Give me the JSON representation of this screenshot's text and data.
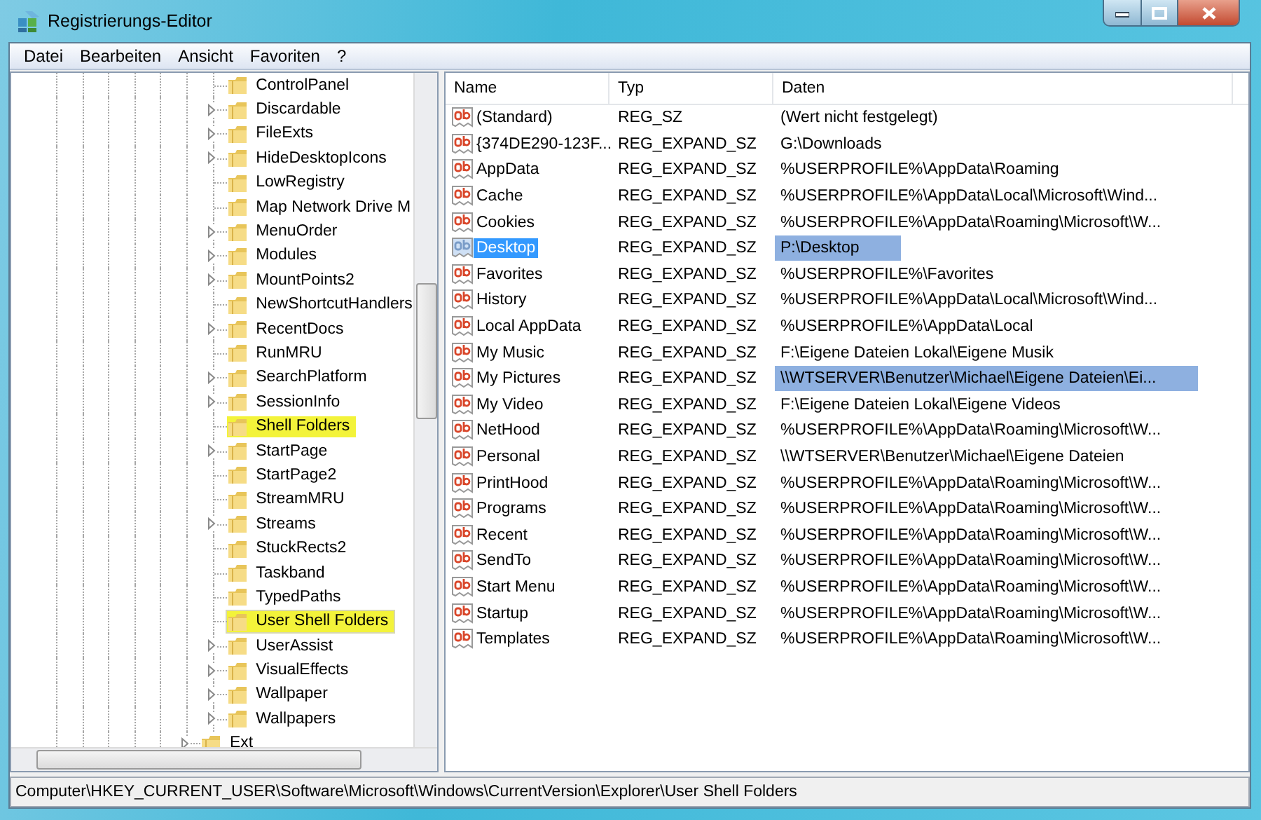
{
  "window": {
    "title": "Registrierungs-Editor"
  },
  "menu": [
    "Datei",
    "Bearbeiten",
    "Ansicht",
    "Favoriten",
    "?"
  ],
  "tree": [
    {
      "children": [
        {
          "label": "ControlPanel",
          "expandable": false,
          "highlighted": false,
          "selected": false
        },
        {
          "label": "Discardable",
          "expandable": true,
          "highlighted": false,
          "selected": false
        },
        {
          "label": "FileExts",
          "expandable": true,
          "highlighted": false,
          "selected": false
        },
        {
          "label": "HideDesktopIcons",
          "expandable": true,
          "highlighted": false,
          "selected": false
        },
        {
          "label": "LowRegistry",
          "expandable": false,
          "highlighted": false,
          "selected": false
        },
        {
          "label": "Map Network Drive M",
          "expandable": false,
          "highlighted": false,
          "selected": false
        },
        {
          "label": "MenuOrder",
          "expandable": true,
          "highlighted": false,
          "selected": false
        },
        {
          "label": "Modules",
          "expandable": true,
          "highlighted": false,
          "selected": false
        },
        {
          "label": "MountPoints2",
          "expandable": true,
          "highlighted": false,
          "selected": false
        },
        {
          "label": "NewShortcutHandlers",
          "expandable": false,
          "highlighted": false,
          "selected": false
        },
        {
          "label": "RecentDocs",
          "expandable": true,
          "highlighted": false,
          "selected": false
        },
        {
          "label": "RunMRU",
          "expandable": false,
          "highlighted": false,
          "selected": false
        },
        {
          "label": "SearchPlatform",
          "expandable": true,
          "highlighted": false,
          "selected": false
        },
        {
          "label": "SessionInfo",
          "expandable": true,
          "highlighted": false,
          "selected": false
        },
        {
          "label": "Shell Folders",
          "expandable": false,
          "highlighted": true,
          "selected": false
        },
        {
          "label": "StartPage",
          "expandable": true,
          "highlighted": false,
          "selected": false
        },
        {
          "label": "StartPage2",
          "expandable": false,
          "highlighted": false,
          "selected": false
        },
        {
          "label": "StreamMRU",
          "expandable": false,
          "highlighted": false,
          "selected": false
        },
        {
          "label": "Streams",
          "expandable": true,
          "highlighted": false,
          "selected": false
        },
        {
          "label": "StuckRects2",
          "expandable": false,
          "highlighted": false,
          "selected": false
        },
        {
          "label": "Taskband",
          "expandable": false,
          "highlighted": false,
          "selected": false
        },
        {
          "label": "TypedPaths",
          "expandable": false,
          "highlighted": false,
          "selected": false
        },
        {
          "label": "User Shell Folders",
          "expandable": false,
          "highlighted": true,
          "selected": true
        },
        {
          "label": "UserAssist",
          "expandable": true,
          "highlighted": false,
          "selected": false
        },
        {
          "label": "VisualEffects",
          "expandable": true,
          "highlighted": false,
          "selected": false
        },
        {
          "label": "Wallpaper",
          "expandable": true,
          "highlighted": false,
          "selected": false
        },
        {
          "label": "Wallpapers",
          "expandable": true,
          "highlighted": false,
          "selected": false
        }
      ]
    },
    {
      "label": "Ext",
      "expandable": true,
      "highlighted": false,
      "selected": false
    }
  ],
  "table": {
    "columns": [
      "Name",
      "Typ",
      "Daten"
    ],
    "rows": [
      {
        "name": "(Standard)",
        "type": "REG_SZ",
        "data": "(Wert nicht festgelegt)",
        "selected": false,
        "data_highlighted": false
      },
      {
        "name": "{374DE290-123F...",
        "type": "REG_EXPAND_SZ",
        "data": "G:\\Downloads",
        "selected": false,
        "data_highlighted": false
      },
      {
        "name": "AppData",
        "type": "REG_EXPAND_SZ",
        "data": "%USERPROFILE%\\AppData\\Roaming",
        "selected": false,
        "data_highlighted": false
      },
      {
        "name": "Cache",
        "type": "REG_EXPAND_SZ",
        "data": "%USERPROFILE%\\AppData\\Local\\Microsoft\\Wind...",
        "selected": false,
        "data_highlighted": false
      },
      {
        "name": "Cookies",
        "type": "REG_EXPAND_SZ",
        "data": "%USERPROFILE%\\AppData\\Roaming\\Microsoft\\W...",
        "selected": false,
        "data_highlighted": false
      },
      {
        "name": "Desktop",
        "type": "REG_EXPAND_SZ",
        "data": "P:\\Desktop",
        "selected": true,
        "data_highlighted": true
      },
      {
        "name": "Favorites",
        "type": "REG_EXPAND_SZ",
        "data": "%USERPROFILE%\\Favorites",
        "selected": false,
        "data_highlighted": false
      },
      {
        "name": "History",
        "type": "REG_EXPAND_SZ",
        "data": "%USERPROFILE%\\AppData\\Local\\Microsoft\\Wind...",
        "selected": false,
        "data_highlighted": false
      },
      {
        "name": "Local AppData",
        "type": "REG_EXPAND_SZ",
        "data": "%USERPROFILE%\\AppData\\Local",
        "selected": false,
        "data_highlighted": false
      },
      {
        "name": "My Music",
        "type": "REG_EXPAND_SZ",
        "data": "F:\\Eigene Dateien Lokal\\Eigene Musik",
        "selected": false,
        "data_highlighted": false
      },
      {
        "name": "My Pictures",
        "type": "REG_EXPAND_SZ",
        "data": "\\\\WTSERVER\\Benutzer\\Michael\\Eigene Dateien\\Ei...",
        "selected": false,
        "data_highlighted": true
      },
      {
        "name": "My Video",
        "type": "REG_EXPAND_SZ",
        "data": "F:\\Eigene Dateien Lokal\\Eigene Videos",
        "selected": false,
        "data_highlighted": false
      },
      {
        "name": "NetHood",
        "type": "REG_EXPAND_SZ",
        "data": "%USERPROFILE%\\AppData\\Roaming\\Microsoft\\W...",
        "selected": false,
        "data_highlighted": false
      },
      {
        "name": "Personal",
        "type": "REG_EXPAND_SZ",
        "data": "\\\\WTSERVER\\Benutzer\\Michael\\Eigene Dateien",
        "selected": false,
        "data_highlighted": false
      },
      {
        "name": "PrintHood",
        "type": "REG_EXPAND_SZ",
        "data": "%USERPROFILE%\\AppData\\Roaming\\Microsoft\\W...",
        "selected": false,
        "data_highlighted": false
      },
      {
        "name": "Programs",
        "type": "REG_EXPAND_SZ",
        "data": "%USERPROFILE%\\AppData\\Roaming\\Microsoft\\W...",
        "selected": false,
        "data_highlighted": false
      },
      {
        "name": "Recent",
        "type": "REG_EXPAND_SZ",
        "data": "%USERPROFILE%\\AppData\\Roaming\\Microsoft\\W...",
        "selected": false,
        "data_highlighted": false
      },
      {
        "name": "SendTo",
        "type": "REG_EXPAND_SZ",
        "data": "%USERPROFILE%\\AppData\\Roaming\\Microsoft\\W...",
        "selected": false,
        "data_highlighted": false
      },
      {
        "name": "Start Menu",
        "type": "REG_EXPAND_SZ",
        "data": "%USERPROFILE%\\AppData\\Roaming\\Microsoft\\W...",
        "selected": false,
        "data_highlighted": false
      },
      {
        "name": "Startup",
        "type": "REG_EXPAND_SZ",
        "data": "%USERPROFILE%\\AppData\\Roaming\\Microsoft\\W...",
        "selected": false,
        "data_highlighted": false
      },
      {
        "name": "Templates",
        "type": "REG_EXPAND_SZ",
        "data": "%USERPROFILE%\\AppData\\Roaming\\Microsoft\\W...",
        "selected": false,
        "data_highlighted": false
      }
    ]
  },
  "status_bar": "Computer\\HKEY_CURRENT_USER\\Software\\Microsoft\\Windows\\CurrentVersion\\Explorer\\User Shell Folders"
}
